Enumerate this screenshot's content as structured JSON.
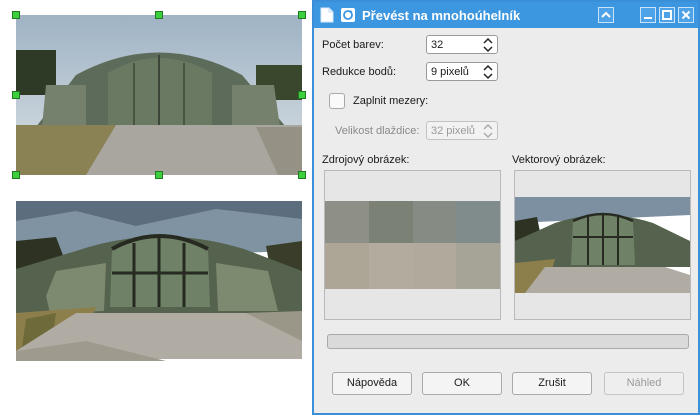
{
  "dialog": {
    "title": "Převést na mnohoúhelník",
    "colors_label": "Počet barev:",
    "colors_value": "32",
    "reduction_label": "Redukce bodů:",
    "reduction_value": "9 pixelů",
    "fill_gaps_label": "Zaplnit mezery:",
    "fill_gaps_checked": false,
    "tile_size_label": "Velikost dlaždice:",
    "tile_size_value": "32 pixelů",
    "source_label": "Zdrojový obrázek:",
    "vector_label": "Vektorový obrázek:",
    "progress": 0,
    "buttons": {
      "help": "Nápověda",
      "ok": "OK",
      "cancel": "Zrušit",
      "preview": "Náhled"
    }
  },
  "colors": {
    "titlebar": "#3d96e0",
    "accent_border": "#3b8fd9",
    "handle": "#3ecf3e"
  },
  "icons": [
    "document-icon",
    "refresh-icon",
    "collapse-icon",
    "minimize-icon",
    "maximize-icon",
    "close-icon",
    "spin-arrows-icon"
  ]
}
